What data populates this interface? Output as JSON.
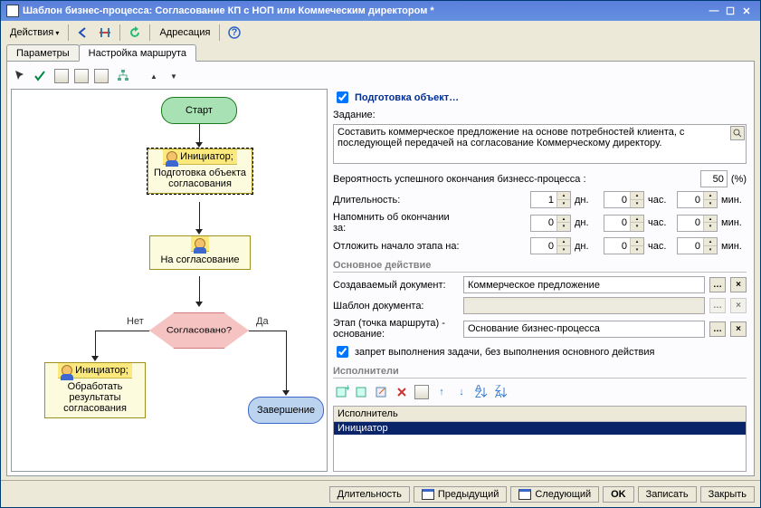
{
  "title": "Шаблон бизнес-процесса: Согласование КП с НОП или Коммеческим директором *",
  "menu": {
    "actions": "Действия",
    "addressing": "Адресация"
  },
  "tabs": {
    "params": "Параметры",
    "route": "Настройка маршрута"
  },
  "flow": {
    "start": "Старт",
    "initiator_header": "Инициатор;",
    "step1_body": "Подготовка объекта согласования",
    "step2": "На согласование",
    "decision": "Согласовано?",
    "yes": "Да",
    "no": "Нет",
    "step3_header": "Инициатор;",
    "step3_body": "Обработать результаты согласования",
    "end": "Завершение"
  },
  "right": {
    "step_title": "Подготовка объект…",
    "task_label": "Задание:",
    "task_text": "Составить коммерческое предложение на основе потребностей клиента, с последующей передачей на согласование Коммерческому директору.",
    "prob_label": "Вероятность успешного окончания бизнесс-процесса :",
    "prob_value": "50",
    "prob_unit": "(%)",
    "duration_label": "Длительность:",
    "remind_label": "Напомнить об окончании за:",
    "delay_label": "Отложить начало этапа на:",
    "u_day": "дн.",
    "u_hour": "час.",
    "u_min": "мин.",
    "main_action": "Основное действие",
    "doc_label": "Создаваемый документ:",
    "doc_value": "Коммерческое предложение",
    "tpl_label": "Шаблон документа:",
    "stage_label": "Этап (точка маршрута) - основание:",
    "stage_value": "Основание бизнес-процесса",
    "forbid": "запрет выполнения задачи, без выполнения основного действия",
    "performers": "Исполнители",
    "grid_header": "Исполнитель",
    "grid_row0": "Инициатор",
    "dur_days": "1",
    "dur_hours": "0",
    "dur_min": "0",
    "rem_days": "0",
    "rem_hours": "0",
    "rem_min": "0",
    "del_days": "0",
    "del_hours": "0",
    "del_min": "0"
  },
  "footer": {
    "duration": "Длительность",
    "prev": "Предыдущий",
    "next": "Следующий",
    "ok": "OK",
    "save": "Записать",
    "close": "Закрыть"
  }
}
